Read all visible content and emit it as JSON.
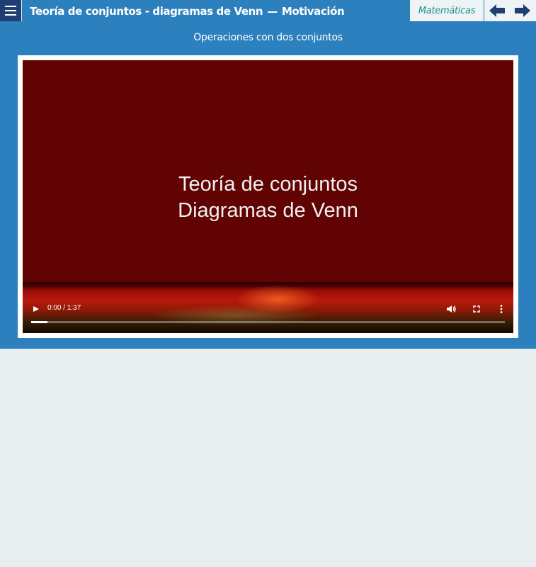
{
  "header": {
    "title": "Teoría de conjuntos - diagramas de Venn",
    "separator": "—",
    "section": "Motivación",
    "subject": "Matemáticas",
    "menu_icon": "hamburger-icon",
    "prev_icon": "arrow-left-icon",
    "next_icon": "arrow-right-icon"
  },
  "main": {
    "heading": "Operaciones con dos conjuntos"
  },
  "video": {
    "title_line1": "Teoría de conjuntos",
    "title_line2": "Diagramas de Venn",
    "current_time": "0:00",
    "duration": "1:37",
    "time_display": "0:00 / 1:37",
    "buffered_fraction": 0.035,
    "icons": [
      "play-icon",
      "volume-icon",
      "fullscreen-icon",
      "more-options-icon"
    ]
  },
  "colors": {
    "header_bg": "#2b80bd",
    "menu_bg": "#1f3f73",
    "subject_text": "#1f8f8a",
    "video_bg": "#620303",
    "nav_arrow": "#1f3f73",
    "page_bg": "#e9eef0"
  }
}
